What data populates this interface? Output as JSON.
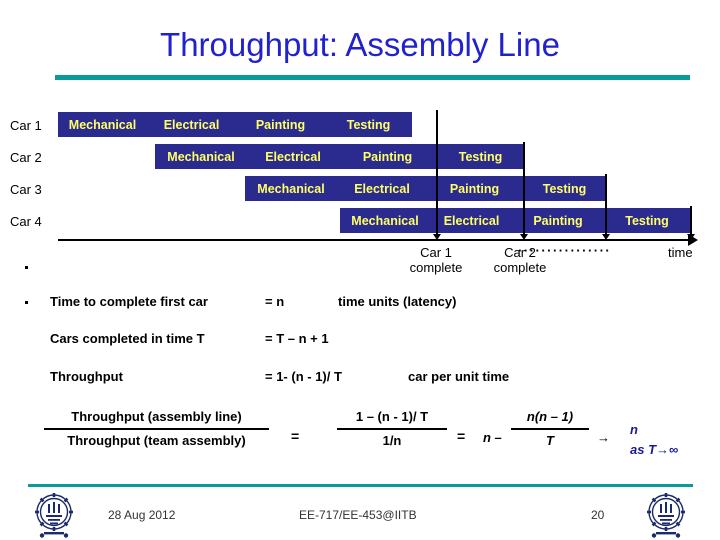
{
  "slide": {
    "title": "Throughput: Assembly Line",
    "accent_color": "#0a9a9a",
    "title_color": "#2222cc",
    "bar_color": "#2b2b8f",
    "bar_text_color": "#ffff66"
  },
  "diagram": {
    "stages": [
      "Mechanical",
      "Electrical",
      "Painting",
      "Testing"
    ],
    "rows": [
      {
        "label": "Car 1",
        "stages": [
          "Mechanical",
          "Electrical",
          "Painting",
          "Testing"
        ]
      },
      {
        "label": "Car 2",
        "stages": [
          "Mechanical",
          "Electrical",
          "Painting",
          "Testing"
        ]
      },
      {
        "label": "Car 3",
        "stages": [
          "Mechanical",
          "Electrical",
          "Painting",
          "Testing"
        ]
      },
      {
        "label": "Car 4",
        "stages": [
          "Mechanical",
          "Electrical",
          "Painting",
          "Testing"
        ]
      }
    ],
    "axis": {
      "time_label": "time",
      "dots": "················",
      "markers": [
        {
          "line1": "Car 1",
          "line2": "complete"
        },
        {
          "line1": "Car 2",
          "line2": "complete"
        }
      ]
    }
  },
  "statements": [
    {
      "label": "Time to complete first car",
      "value": "= n",
      "note": "time units (latency)"
    },
    {
      "label": "Cars completed in time T",
      "value": "= T – n + 1",
      "note": ""
    },
    {
      "label": "Throughput",
      "value": "= 1- (n - 1)/ T",
      "note": "car per unit time"
    }
  ],
  "equation": {
    "lhs_numerator": "Throughput (assembly line)",
    "lhs_denominator": "Throughput (team assembly)",
    "equals_1": "=",
    "mid_numerator": "1 – (n - 1)/ T",
    "mid_denominator": "1/n",
    "equals_2": "=",
    "rhs_prefix": "n –",
    "rhs_numerator": "n(n – 1)",
    "rhs_denominator": "T",
    "arrow": "→",
    "limit_value": "n",
    "limit_condition": "as T→∞",
    "limit_color": "#1a1a99"
  },
  "footer": {
    "date": "28 Aug 2012",
    "course": "EE-717/EE-453@IITB",
    "page_number": "20"
  }
}
